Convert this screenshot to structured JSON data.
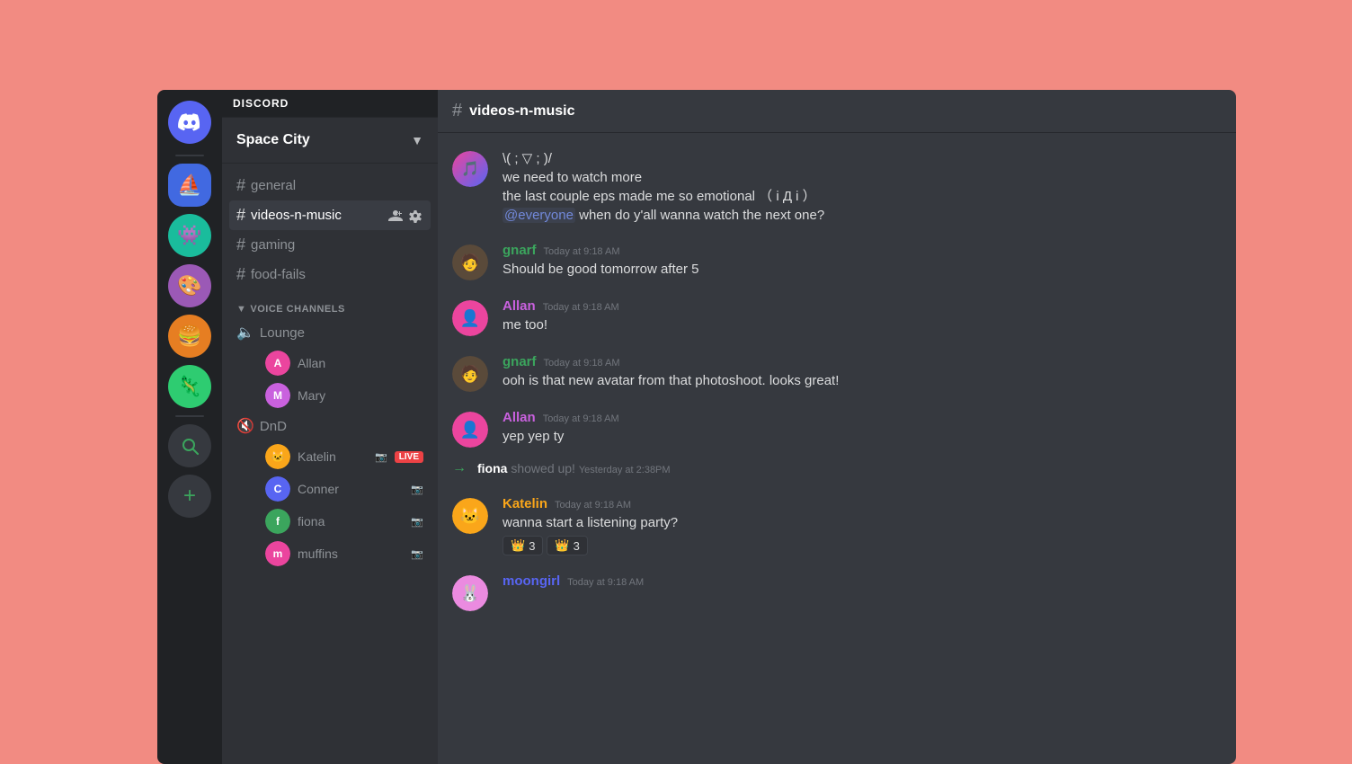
{
  "app": {
    "title": "DISCORD"
  },
  "servers": [
    {
      "id": "discord",
      "icon": "🎮",
      "label": "Discord Home",
      "bg": "#5865f2"
    },
    {
      "id": "sailboat",
      "icon": "⛵",
      "label": "Sailboat Server",
      "bg": "#4169e1"
    },
    {
      "id": "alien",
      "icon": "👾",
      "label": "Alien Server",
      "bg": "#1abc9c"
    },
    {
      "id": "art",
      "icon": "🎨",
      "label": "Art Server",
      "bg": "#9b59b6"
    },
    {
      "id": "food",
      "icon": "🍔",
      "label": "Food Server",
      "bg": "#e67e22"
    },
    {
      "id": "creature",
      "icon": "🦎",
      "label": "Creature Server",
      "bg": "#2ecc71"
    }
  ],
  "sidebar": {
    "server_name": "Space City",
    "channels": [
      {
        "id": "general",
        "name": "general",
        "type": "text",
        "active": false
      },
      {
        "id": "videos-n-music",
        "name": "videos-n-music",
        "type": "text",
        "active": true
      },
      {
        "id": "gaming",
        "name": "gaming",
        "type": "text",
        "active": false
      },
      {
        "id": "food-fails",
        "name": "food-fails",
        "type": "text",
        "active": false
      }
    ],
    "voice_category": "VOICE CHANNELS",
    "voice_channels": [
      {
        "id": "lounge",
        "name": "Lounge",
        "users": [
          {
            "name": "Allan",
            "color": "#3ba55d"
          },
          {
            "name": "Mary",
            "color": "#c961de"
          }
        ]
      },
      {
        "id": "dnd",
        "name": "DnD",
        "users": [
          {
            "name": "Katelin",
            "color": "#faa61a",
            "live": true,
            "video": true
          },
          {
            "name": "Conner",
            "color": "#8e9297",
            "video": true
          },
          {
            "name": "fiona",
            "color": "#3ba55d",
            "video": true
          },
          {
            "name": "muffins",
            "color": "#eb459e",
            "video": true
          }
        ]
      }
    ]
  },
  "chat": {
    "channel_name": "videos-n-music",
    "messages": [
      {
        "id": "msg1",
        "type": "continuation",
        "kaomoji": "\\( ; ▽ ; )/",
        "lines": [
          "we need to watch more",
          "the last couple eps made me so emotional （ і Д і ）"
        ],
        "mention": "@everyone",
        "mention_suffix": " when do y'all wanna watch the next one?"
      },
      {
        "id": "msg2",
        "type": "message",
        "username": "gnarf",
        "username_color": "green",
        "timestamp": "Today at 9:18 AM",
        "text": "Should be good tomorrow after 5",
        "avatar_color": "#5a4a3a",
        "avatar_emoji": "🧑"
      },
      {
        "id": "msg3",
        "type": "message",
        "username": "Allan",
        "username_color": "purple",
        "timestamp": "Today at 9:18 AM",
        "text": "me too!",
        "avatar_color": "#eb459e",
        "avatar_emoji": "👤"
      },
      {
        "id": "msg4",
        "type": "message",
        "username": "gnarf",
        "username_color": "green",
        "timestamp": "Today at 9:18 AM",
        "text": "ooh is that new avatar from that photoshoot. looks great!",
        "avatar_color": "#5a4a3a",
        "avatar_emoji": "🧑"
      },
      {
        "id": "msg5",
        "type": "message",
        "username": "Allan",
        "username_color": "purple",
        "timestamp": "Today at 9:18 AM",
        "text": "yep yep ty",
        "avatar_color": "#eb459e",
        "avatar_emoji": "👤"
      },
      {
        "id": "msg6",
        "type": "system",
        "username": "fiona",
        "action": "showed up!",
        "timestamp": "Yesterday at 2:38PM"
      },
      {
        "id": "msg7",
        "type": "message",
        "username": "Katelin",
        "username_color": "orange",
        "timestamp": "Today at 9:18 AM",
        "text": "wanna start a listening party?",
        "avatar_color": "#faa61a",
        "avatar_emoji": "🐱",
        "reactions": [
          {
            "emoji": "👑",
            "count": 3
          },
          {
            "emoji": "👑",
            "count": 3
          }
        ]
      },
      {
        "id": "msg8",
        "type": "message",
        "username": "moongirl",
        "username_color": "blue",
        "timestamp": "Today at 9:18 AM",
        "text": "",
        "avatar_color": "#eb8be0",
        "avatar_emoji": "🐰"
      }
    ]
  }
}
